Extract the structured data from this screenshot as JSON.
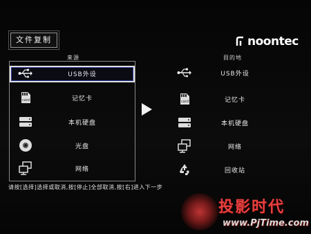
{
  "window": {
    "title": "文件复制"
  },
  "brand": {
    "logo_text": "noontec"
  },
  "source": {
    "header": "来源",
    "items": [
      {
        "label": "USB外设",
        "icon": "usb-icon",
        "selected": true
      },
      {
        "label": "记忆卡",
        "icon": "memory-card-icon",
        "selected": false
      },
      {
        "label": "本机硬盘",
        "icon": "hard-disk-icon",
        "selected": false
      },
      {
        "label": "光盘",
        "icon": "optical-disc-icon",
        "selected": false
      },
      {
        "label": "网络",
        "icon": "network-icon",
        "selected": false
      }
    ]
  },
  "destination": {
    "header": "目的地",
    "items": [
      {
        "label": "USB外设",
        "icon": "usb-icon"
      },
      {
        "label": "记忆卡",
        "icon": "memory-card-icon"
      },
      {
        "label": "本机硬盘",
        "icon": "hard-disk-icon"
      },
      {
        "label": "网络",
        "icon": "network-icon"
      },
      {
        "label": "回收站",
        "icon": "recycle-bin-icon"
      }
    ]
  },
  "hint": "请按[选择]选择或取消,按[停止]全部取消,按[右]进入下一步",
  "watermark": {
    "title": "投影时代",
    "url": "www.PjTime.com"
  },
  "colors": {
    "background": "#000000",
    "selection_border": "#2a3a9a",
    "watermark_red": "#e84040"
  }
}
